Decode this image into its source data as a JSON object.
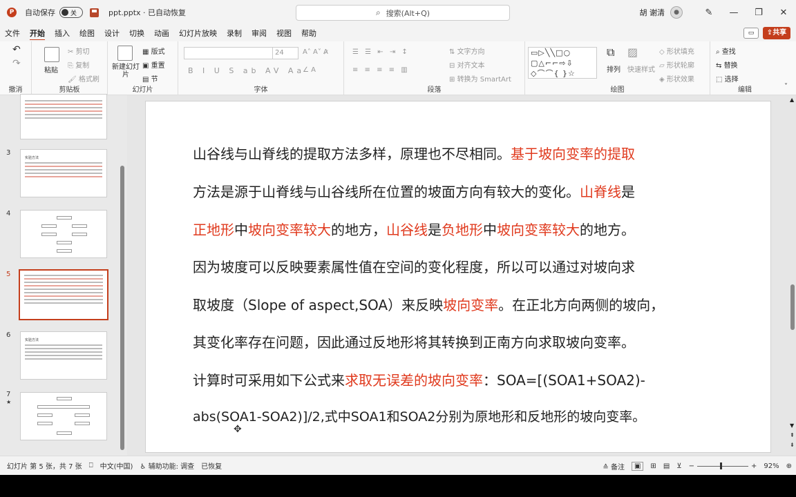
{
  "titlebar": {
    "autosave_label": "自动保存",
    "toggle_state": "关",
    "doc_title": "ppt.pptx · 已自动恢复",
    "search_placeholder": "搜索(Alt+Q)",
    "user_name": "胡 谢清",
    "minimize": "—",
    "restore": "❐",
    "close": "✕"
  },
  "tabs": [
    "文件",
    "开始",
    "插入",
    "绘图",
    "设计",
    "切换",
    "动画",
    "幻灯片放映",
    "录制",
    "审阅",
    "视图",
    "帮助"
  ],
  "active_tab": "开始",
  "share_label": "共享",
  "ribbon": {
    "undo": "撤消",
    "clipboard": {
      "paste": "粘贴",
      "cut": "剪切",
      "copy": "复制",
      "format_painter": "格式刷",
      "label": "剪贴板"
    },
    "slides": {
      "new_slide": "新建幻灯片",
      "layout": "版式",
      "reset": "重置",
      "section": "节",
      "label": "幻灯片"
    },
    "font": {
      "size": "24",
      "label": "字体"
    },
    "paragraph": {
      "text_direction": "文字方向",
      "align_text": "对齐文本",
      "smartart": "转换为 SmartArt",
      "label": "段落"
    },
    "drawing": {
      "arrange": "排列",
      "quick_styles": "快速样式",
      "fill": "形状填充",
      "outline": "形状轮廓",
      "effects": "形状效果",
      "label": "绘图"
    },
    "editing": {
      "find": "查找",
      "replace": "替换",
      "select": "选择",
      "label": "编辑"
    }
  },
  "thumbnails": [
    {
      "num": "3",
      "title": "实验方法"
    },
    {
      "num": "4",
      "title": ""
    },
    {
      "num": "5",
      "title": ""
    },
    {
      "num": "6",
      "title": "实验方法"
    },
    {
      "num": "7",
      "title": ""
    }
  ],
  "slide": {
    "lines": [
      [
        {
          "t": "山谷线与山脊线的提取方法多样，原理也不尽相同。",
          "red": false
        },
        {
          "t": "基于坡向变率的提取",
          "red": true
        }
      ],
      [
        {
          "t": "方法是源于山脊线与山谷线所在位置的坡面方向有较大的变化。",
          "red": false
        },
        {
          "t": "山脊线",
          "red": true
        },
        {
          "t": "是",
          "red": false
        }
      ],
      [
        {
          "t": "正地形",
          "red": true
        },
        {
          "t": "中",
          "red": false
        },
        {
          "t": "坡向变率较大",
          "red": true
        },
        {
          "t": "的地方，",
          "red": false
        },
        {
          "t": "山谷线",
          "red": true
        },
        {
          "t": "是",
          "red": false
        },
        {
          "t": "负地形",
          "red": true
        },
        {
          "t": "中",
          "red": false
        },
        {
          "t": "坡向变率较大",
          "red": true
        },
        {
          "t": "的地方。",
          "red": false
        }
      ],
      [
        {
          "t": "因为坡度可以反映要素属性值在空间的变化程度，所以可以通过对坡向求",
          "red": false
        }
      ],
      [
        {
          "t": "取坡度（Slope of aspect,SOA）来反映",
          "red": false
        },
        {
          "t": "坡向变率",
          "red": true
        },
        {
          "t": "。在正北方向两侧的坡向，",
          "red": false
        }
      ],
      [
        {
          "t": "其变化率存在问题，因此通过反地形将其转换到正南方向求取坡向变率。",
          "red": false
        }
      ],
      [
        {
          "t": "计算时可采用如下公式来",
          "red": false
        },
        {
          "t": "求取无误差的坡向变率",
          "red": true
        },
        {
          "t": "：SOA=[(SOA1+SOA2)-",
          "red": false
        }
      ],
      [
        {
          "t": "abs(SOA1-SOA2)]/2,式中SOA1和SOA2分别为原地形和反地形的坡向变率。",
          "red": false
        }
      ]
    ]
  },
  "status": {
    "slide_count": "幻灯片 第 5 张，共 7 张",
    "language": "中文(中国)",
    "accessibility": "辅助功能: 调查",
    "recovered": "已恢复",
    "notes": "备注",
    "zoom": "92%"
  }
}
